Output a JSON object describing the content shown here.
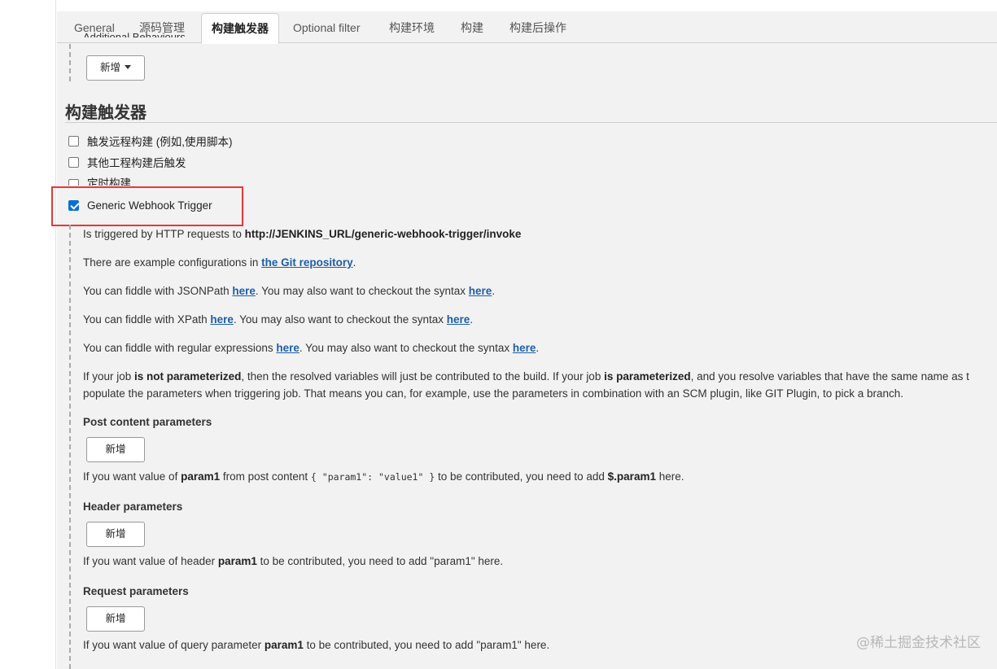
{
  "tabs": [
    {
      "label": "General",
      "active": false
    },
    {
      "label": "源码管理",
      "active": false
    },
    {
      "label": "构建触发器",
      "active": true
    },
    {
      "label": "Optional filter",
      "active": false
    },
    {
      "label": "构建环境",
      "active": false
    },
    {
      "label": "构建",
      "active": false
    },
    {
      "label": "构建后操作",
      "active": false
    }
  ],
  "clipped_label": "Additional Behaviours",
  "add_dropdown_label": "新增",
  "section_title": "构建触发器",
  "triggers": [
    {
      "label": "触发远程构建 (例如,使用脚本)",
      "checked": false
    },
    {
      "label": "其他工程构建后触发",
      "checked": false
    },
    {
      "label": "定时构建",
      "checked": false
    },
    {
      "label": "Generic Webhook Trigger",
      "checked": true
    }
  ],
  "help": {
    "triggered_prefix": "Is triggered by HTTP requests to ",
    "triggered_url": "http://JENKINS_URL/generic-webhook-trigger/invoke",
    "examples_prefix": "There are example configurations in ",
    "examples_link": "the Git repository",
    "examples_suffix": ".",
    "jsonpath_prefix": "You can fiddle with JSONPath ",
    "xpath_prefix": "You can fiddle with XPath ",
    "regex_prefix": "You can fiddle with regular expressions ",
    "here": "here",
    "syntax_mid": ". You may also want to checkout the syntax ",
    "dot": ".",
    "param_p1_a": "If your job ",
    "param_p1_b": "is not parameterized",
    "param_p1_c": ", then the resolved variables will just be contributed to the build. If your job ",
    "param_p1_d": "is parameterized",
    "param_p1_e": ", and you resolve variables that have the same name as t",
    "param_p2": "populate the parameters when triggering job. That means you can, for example, use the parameters in combination with an SCM plugin, like GIT Plugin, to pick a branch."
  },
  "post_content": {
    "heading": "Post content parameters",
    "button": "新增",
    "desc_a": "If you want value of ",
    "desc_b": "param1",
    "desc_c": " from post content ",
    "desc_code": "{ \"param1\": \"value1\" }",
    "desc_d": " to be contributed, you need to add ",
    "desc_e": "$.param1",
    "desc_f": " here."
  },
  "header_params": {
    "heading": "Header parameters",
    "button": "新增",
    "desc_a": "If you want value of header ",
    "desc_b": "param1",
    "desc_c": " to be contributed, you need to add \"param1\" here."
  },
  "request_params": {
    "heading": "Request parameters",
    "button": "新增",
    "desc_a": "If you want value of query parameter ",
    "desc_b": "param1",
    "desc_c": " to be contributed, you need to add \"param1\" here."
  },
  "watermark": "@稀土掘金技术社区"
}
